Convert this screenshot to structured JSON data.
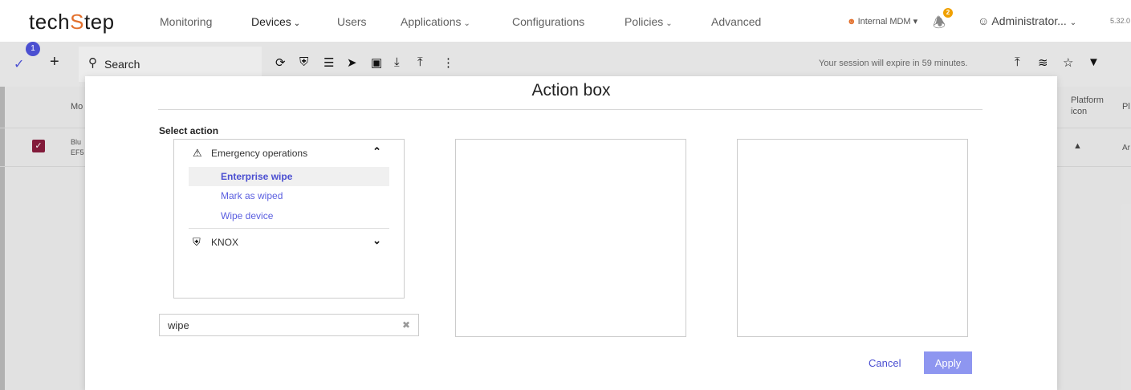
{
  "header": {
    "logo_text_1": "tech",
    "logo_accent": "S",
    "logo_text_2": "tep",
    "nav": [
      {
        "label": "Monitoring",
        "dropdown": false,
        "active": false
      },
      {
        "label": "Devices",
        "dropdown": true,
        "active": true
      },
      {
        "label": "Users",
        "dropdown": false,
        "active": false
      },
      {
        "label": "Applications",
        "dropdown": true,
        "active": false
      },
      {
        "label": "Configurations",
        "dropdown": false,
        "active": false
      },
      {
        "label": "Policies",
        "dropdown": true,
        "active": false
      },
      {
        "label": "Advanced",
        "dropdown": false,
        "active": false
      }
    ],
    "tenant_label": "Internal MDM",
    "notification_count": "2",
    "user_label": "Administrator...",
    "version": "5.32.0"
  },
  "toolbar": {
    "selected_count": "1",
    "search_label": "Search",
    "session_text": "Your session will expire in 59 minutes."
  },
  "table": {
    "col_model_partial": "Mo",
    "row_model_partial_1": "Blu",
    "row_model_partial_2": "EF5",
    "col_platform_icon": "Platform icon",
    "col_pl_partial": "Pl",
    "row_platform_partial": "Ar"
  },
  "modal": {
    "title": "Action box",
    "select_label": "Select action",
    "groups": [
      {
        "label": "Emergency operations",
        "icon": "warning-icon",
        "expanded": true,
        "items": [
          {
            "label": "Enterprise wipe",
            "selected": true
          },
          {
            "label": "Mark as wiped",
            "selected": false
          },
          {
            "label": "Wipe device",
            "selected": false
          }
        ]
      },
      {
        "label": "KNOX",
        "icon": "shield-icon",
        "expanded": false,
        "items": []
      }
    ],
    "filter_value": "wipe",
    "cancel_label": "Cancel",
    "apply_label": "Apply"
  },
  "colors": {
    "accent": "#4b4fd1",
    "logo_accent": "#e3702c",
    "apply_button": "#8e96f0",
    "checkbox": "#8b1d3e"
  }
}
